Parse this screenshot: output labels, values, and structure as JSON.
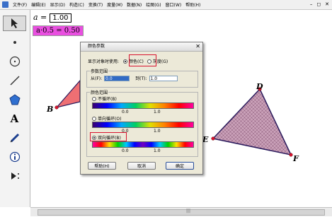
{
  "menu": {
    "items": [
      "文件(F)",
      "编辑(E)",
      "显示(D)",
      "构造(C)",
      "变换(T)",
      "度量(M)",
      "数据(N)",
      "绘图(G)",
      "窗口(W)",
      "帮助(H)"
    ],
    "controls": [
      "–",
      "◻",
      "✕"
    ]
  },
  "toolbar": {
    "tools": [
      "arrow-tool",
      "point-tool",
      "compass-tool",
      "line-tool",
      "polygon-tool",
      "text-tool",
      "marker-tool",
      "info-tool",
      "custom-tool"
    ],
    "text_tool_label": "A"
  },
  "canvas": {
    "measure_a": {
      "var": "a =",
      "value": "1.00"
    },
    "measure_expr": "a·0.5 = 0.50",
    "points": [
      "B",
      "D",
      "E",
      "F"
    ]
  },
  "dialog": {
    "title": "颜色参数",
    "close": "✕",
    "display_label": "显示对象时使用:",
    "option_color": "颜色(C)",
    "option_gray": "灰度(G)",
    "range_group": "参数范围",
    "from_label": "从(F):",
    "from_value": "0.0",
    "to_label": "到(T):",
    "to_value": "1.0",
    "color_range_group": "颜色范围",
    "mode_none": "不循环(B)",
    "mode_single": "单向循环(O)",
    "mode_double": "双向循环(B)",
    "tick_0": "0.0",
    "tick_1": "1.0",
    "btn_help": "帮助(H)",
    "btn_cancel": "取消",
    "btn_ok": "确定"
  },
  "colors": {
    "highlight": "#d8132f",
    "triangle_fill": "#c9a0b8",
    "triangle_edge": "#2a1a5c",
    "point": "#d8132f",
    "measure_bg": "#e94fe0",
    "partial_triangle": "#ee6f73"
  }
}
